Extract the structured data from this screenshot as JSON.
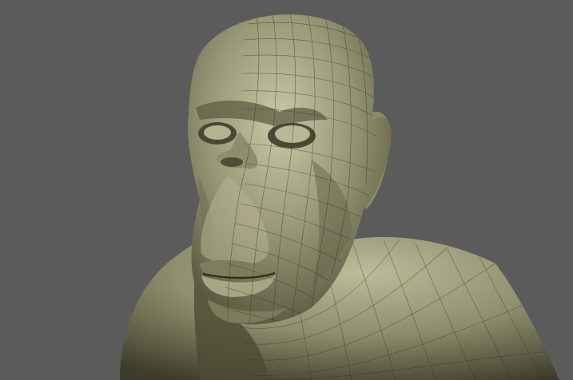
{
  "viewport": {
    "background_color": "#5b5b5b",
    "content": "sculpted-bust-3d-model",
    "model": {
      "material_color": "#9b9a78",
      "highlight_color": "#c9c8a7",
      "shadow_color": "#3e3d2b",
      "wireframe_color": "#2f2f25",
      "wireframe_overlay": "right-half"
    }
  }
}
